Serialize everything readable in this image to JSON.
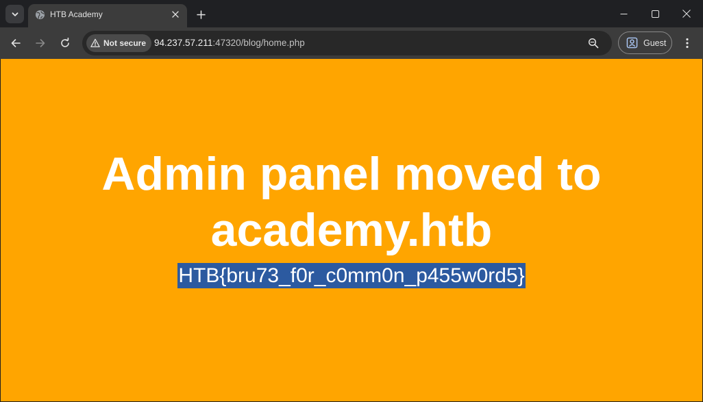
{
  "browser": {
    "tab_title": "HTB Academy",
    "security_label": "Not secure",
    "url_host": "94.237.57.211",
    "url_rest": ":47320/blog/home.php",
    "profile_label": "Guest"
  },
  "icons": {
    "tab_search": "chevron-down-icon",
    "favicon": "globe-icon",
    "tab_close": "close-icon",
    "new_tab": "plus-icon",
    "back": "arrow-left-icon",
    "forward": "arrow-right-icon",
    "reload": "reload-icon",
    "security": "warning-triangle-icon",
    "zoom": "zoom-icon",
    "profile": "person-icon",
    "menu": "kebab-menu-icon",
    "minimize": "minimize-icon",
    "maximize": "maximize-icon",
    "close_window": "close-icon"
  },
  "page": {
    "headline_line1": "Admin panel moved to",
    "headline_line2": "academy.htb",
    "selected_flag": "HTB{bru73_f0r_c0mm0n_p455w0rd5}"
  },
  "colors": {
    "page_background": "#ffa500",
    "headline_text": "#ffffff",
    "selection_highlight": "#2c5aa0"
  }
}
